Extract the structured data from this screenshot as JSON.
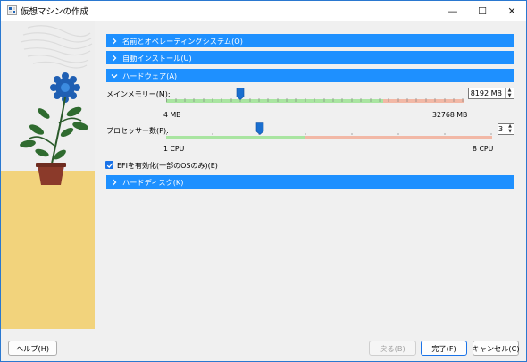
{
  "window": {
    "title": "仮想マシンの作成"
  },
  "title_controls": {
    "minimize": "—",
    "maximize": "☐",
    "close": "✕"
  },
  "sections": {
    "name_os": {
      "label": "名前とオペレーティングシステム(O)",
      "state": "collapsed"
    },
    "unattended": {
      "label": "自動インストール(U)",
      "state": "collapsed"
    },
    "hardware": {
      "label": "ハードウェア(A)",
      "state": "expanded"
    },
    "hard_disk": {
      "label": "ハードディスク(K)",
      "state": "collapsed"
    }
  },
  "hardware": {
    "memory": {
      "label": "メインメモリー(M):",
      "value": "8192 MB",
      "min_label": "4 MB",
      "max_label": "32768 MB",
      "min": 4,
      "max": 32768,
      "current": 8192,
      "recommended_max_fraction": 0.73
    },
    "processors": {
      "label": "プロセッサー数(P):",
      "value": "3",
      "min_label": "1 CPU",
      "max_label": "8 CPU",
      "min": 1,
      "max": 8,
      "current": 3,
      "recommended_max": 4
    },
    "efi": {
      "label": "EFIを有効化(一部のOSのみ)(E)",
      "checked": true
    }
  },
  "footer": {
    "help": "ヘルプ(H)",
    "back": "戻る(B)",
    "finish": "完了(F)",
    "cancel": "キャンセル(C)"
  },
  "colors": {
    "section_header": "#1e90ff",
    "slider_ok": "#a9e5a1",
    "slider_warn": "#f2b8a6",
    "slider_thumb": "#1a6fd0",
    "side_floor": "#f2d37c"
  },
  "icons": {
    "app": "virtualbox-icon",
    "collapsed": "chevron-right-icon",
    "expanded": "chevron-down-icon",
    "check": "checkmark-icon"
  }
}
